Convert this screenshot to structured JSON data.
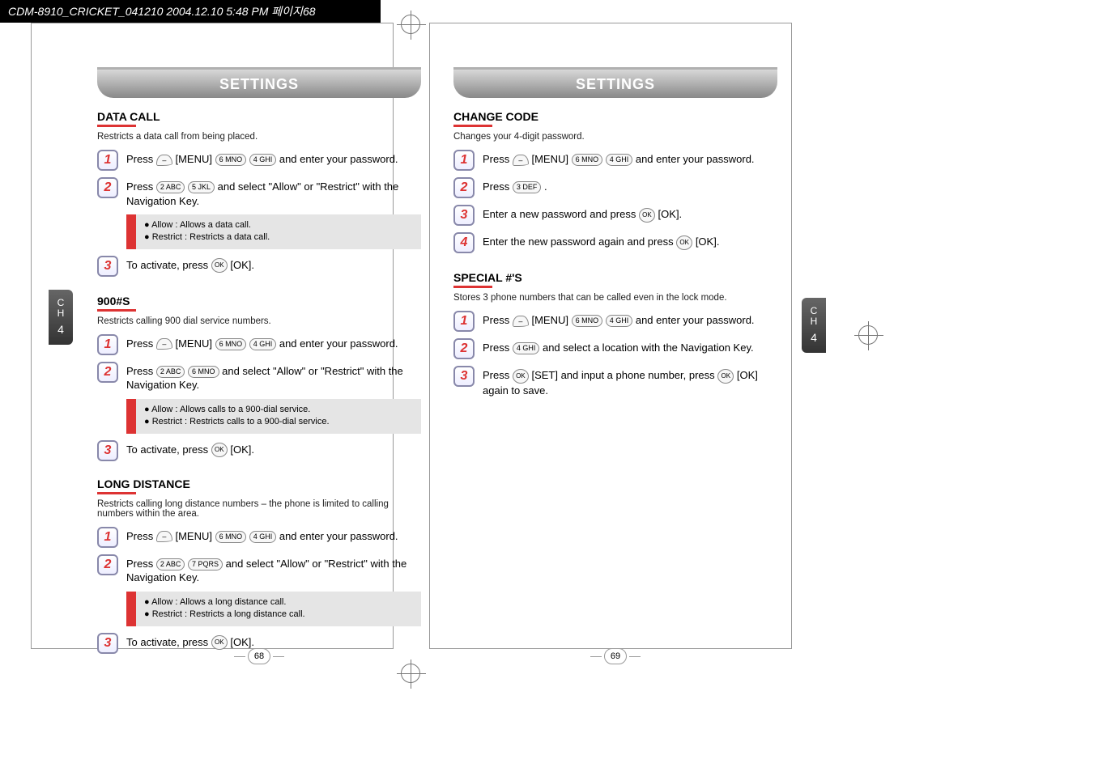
{
  "header": {
    "filename_stamp": "CDM-8910_CRICKET_041210  2004.12.10 5:48 PM  페이지68"
  },
  "left": {
    "tab_title": "SETTINGS",
    "side_tab_line1": "C",
    "side_tab_line2": "H",
    "side_tab_line3": "4",
    "page_number": "68",
    "sections": {
      "data_call": {
        "title": "DATA CALL",
        "desc": "Restricts a data call from being placed.",
        "step1": "Press       [MENU]             and enter your password.",
        "step2": "Press             and select \"Allow\" or \"Restrict\" with the Navigation Key.",
        "note1": "Allow : Allows a data call.",
        "note2": "Restrict : Restricts a data call.",
        "step3": "To activate, press        [OK]."
      },
      "nine_hundred": {
        "title": "900#S",
        "desc": "Restricts calling 900 dial service numbers.",
        "step1": "Press       [MENU]             and enter your password.",
        "step2": "Press             and select \"Allow\" or \"Restrict\" with the Navigation Key.",
        "note1": "Allow : Allows calls to a 900-dial service.",
        "note2": "Restrict : Restricts calls to a 900-dial service.",
        "step3": "To activate, press        [OK]."
      },
      "long_distance": {
        "title": "LONG DISTANCE",
        "desc": "Restricts calling long distance numbers – the phone is limited to calling numbers within the area.",
        "step1": "Press       [MENU]             and enter your password.",
        "step2": "Press             and select \"Allow\" or \"Restrict\" with the Navigation Key.",
        "note1": "Allow : Allows a long distance call.",
        "note2": "Restrict : Restricts a long distance call.",
        "step3": "To activate, press        [OK]."
      }
    }
  },
  "right": {
    "tab_title": "SETTINGS",
    "side_tab_line1": "C",
    "side_tab_line2": "H",
    "side_tab_line3": "4",
    "page_number": "69",
    "sections": {
      "change_code": {
        "title": "CHANGE CODE",
        "desc": "Changes your 4-digit password.",
        "step1": "Press       [MENU]             and enter your password.",
        "step2": "Press        .",
        "step3": "Enter a new password and press        [OK].",
        "step4": "Enter the new password again and press        [OK]."
      },
      "special_numbers": {
        "title": "SPECIAL #'S",
        "desc": "Stores 3 phone numbers that can be called even in the lock mode.",
        "step1": "Press       [MENU]             and enter your password.",
        "step2": "Press        and select a location with the Navigation Key.",
        "step3": "Press        [SET] and input a phone number, press        [OK] again to save."
      }
    }
  },
  "key_labels": {
    "soft": "–",
    "two": "2 ABC",
    "three": "3 DEF",
    "four": "4 GHI",
    "five": "5 JKL",
    "six": "6 MNO",
    "seven": "7 PQRS",
    "ok": "OK"
  }
}
